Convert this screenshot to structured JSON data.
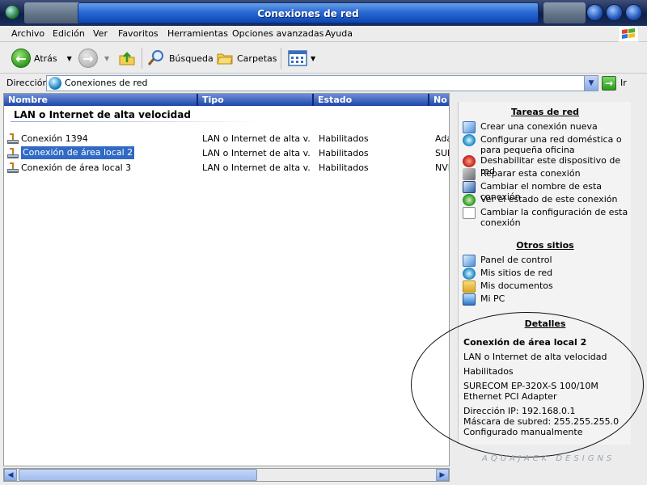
{
  "window": {
    "title": "Conexiones de red"
  },
  "menu": [
    "Archivo",
    "Edición",
    "Ver",
    "Favoritos",
    "Herramientas",
    "Opciones avanzadas",
    "Ayuda"
  ],
  "toolbar": {
    "back_label": "Atrás",
    "search_label": "Búsqueda",
    "folders_label": "Carpetas"
  },
  "address": {
    "label": "Dirección",
    "value": "Conexiones de red",
    "go_label": "Ir"
  },
  "columns": [
    "Nombre",
    "Tipo",
    "Estado",
    "No"
  ],
  "group": {
    "title": "LAN o Internet de alta velocidad"
  },
  "rows": [
    {
      "name": "Conexión 1394",
      "type": "LAN o Internet de alta v...",
      "state": "Habilitados",
      "device": "Ada"
    },
    {
      "name": "Conexión de área local 2",
      "type": "LAN o Internet de alta v...",
      "state": "Habilitados",
      "device": "SUR"
    },
    {
      "name": "Conexión de área local 3",
      "type": "LAN o Internet de alta v...",
      "state": "Habilitados",
      "device": "NVI"
    }
  ],
  "network_tasks": {
    "title": "Tareas de red",
    "items": [
      "Crear una conexión nueva",
      "Configurar una red doméstica o para pequeña oficina",
      "Deshabilitar este dispositivo de red",
      "Reparar esta conexión",
      "Cambiar el nombre de esta conexión",
      "Ver el estado de este conexión",
      "Cambiar la configuración de esta conexión"
    ]
  },
  "other_places": {
    "title": "Otros sitios",
    "items": [
      "Panel de control",
      "Mis sitios de red",
      "Mis documentos",
      "Mi PC"
    ]
  },
  "details": {
    "title": "Detalles",
    "name": "Conexión de área local 2",
    "type": "LAN o Internet de alta velocidad",
    "state": "Habilitados",
    "adapter": "SURECOM EP-320X-S 100/10M Ethernet PCI Adapter",
    "ip": "Dirección IP: 192.168.0.1",
    "mask": "Máscara de subred: 255.255.255.0",
    "config": "Configurado manualmente"
  },
  "watermark": "AQUAJACK DESIGNS"
}
